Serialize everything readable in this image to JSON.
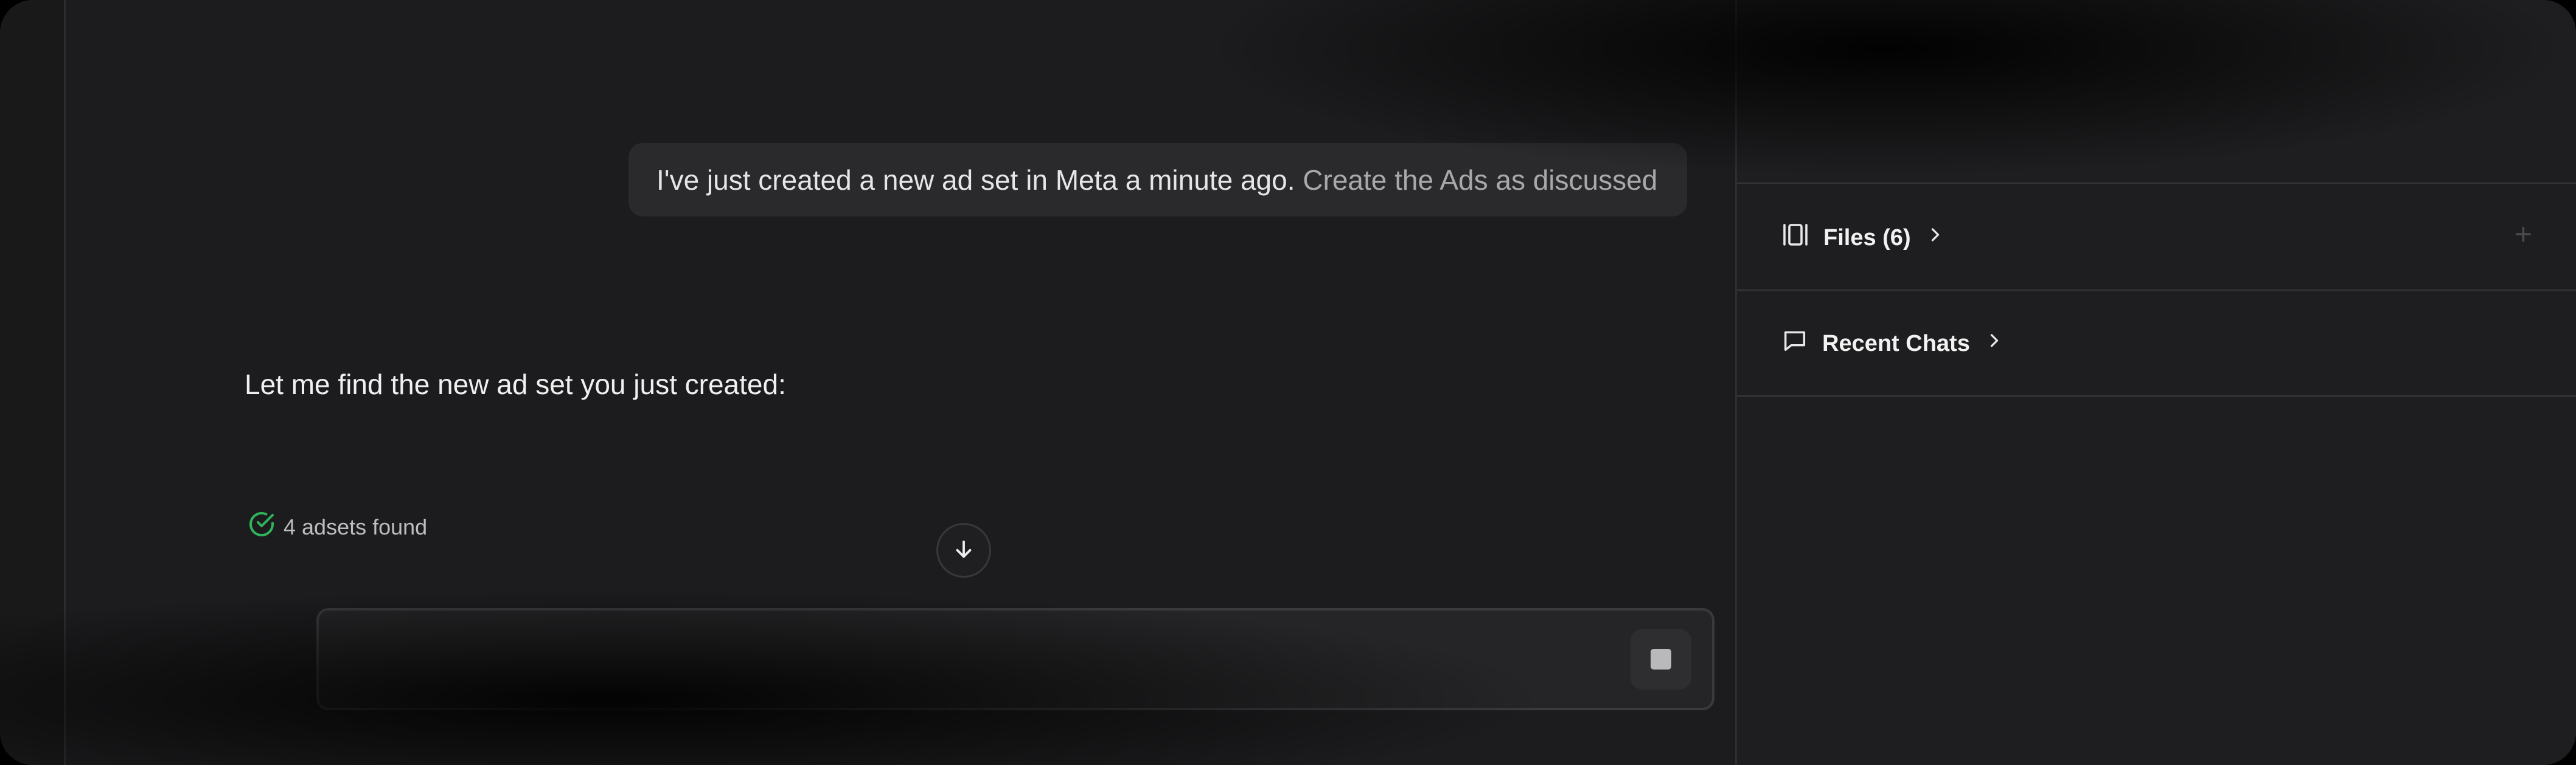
{
  "conversation": {
    "user_message_main": "I've just created a new ad set in Meta a minute ago.",
    "user_message_faded": "Create the Ads as discussed",
    "assistant_message": "Let me find the new ad set you just created:",
    "tool_status": "4 adsets found"
  },
  "sidebar": {
    "files_label": "Files (6)",
    "recent_chats_label": "Recent Chats",
    "add_symbol": "+"
  },
  "colors": {
    "success_green": "#2fb45a",
    "background": "#1c1c1e",
    "panel": "#1e1e20"
  },
  "icons": {
    "tool_status": "check-circle-icon",
    "scroll": "arrow-down-icon",
    "files": "files-icon",
    "recent_chats": "chat-bubble-icon",
    "chevron": "chevron-right-icon",
    "stop": "stop-icon"
  }
}
